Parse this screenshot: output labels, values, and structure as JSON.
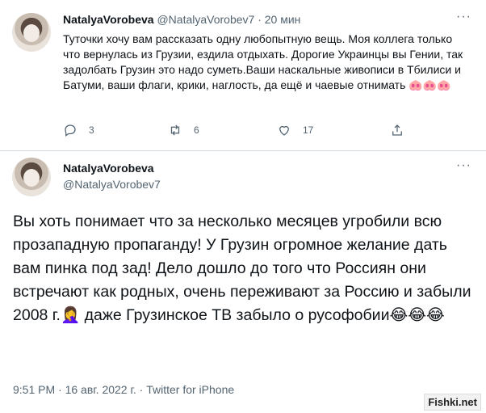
{
  "tweet1": {
    "name": "NatalyaVorobeva",
    "handle": "@NatalyaVorobev7",
    "dot": "·",
    "time": "20 мин",
    "text": "Туточки хочу вам рассказать одну любопытную вещь. Моя коллега только что вернулась из Грузии, ездила отдыхать. Дорогие Украинцы вы Гении, так задолбать Грузин это надо суметь.Ваши наскальные живописи в Тбилиси и Батуми, ваши флаги, крики, наглость, да ещё и чаевые отнимать 🐽🐽🐽",
    "replies": "3",
    "retweets": "6",
    "likes": "17",
    "icons": [
      "reply-icon",
      "retweet-icon",
      "like-icon",
      "share-icon"
    ]
  },
  "tweet2": {
    "name": "NatalyaVorobeva",
    "handle": "@NatalyaVorobev7",
    "text": "Вы хоть понимает что за несколько месяцев угробили всю прозападную пропаганду! У Грузин огромное желание дать вам пинка под зад! Дело дошло до того что Россиян они встречают как родных, очень переживают за Россию и забыли 2008 г.🤦‍♀️ даже Грузинское ТВ забыло о русофобии😂😂😂",
    "meta": "9:51 PM · 16 авг. 2022 г. · Twitter for iPhone"
  },
  "watermark": "Fishki.net"
}
